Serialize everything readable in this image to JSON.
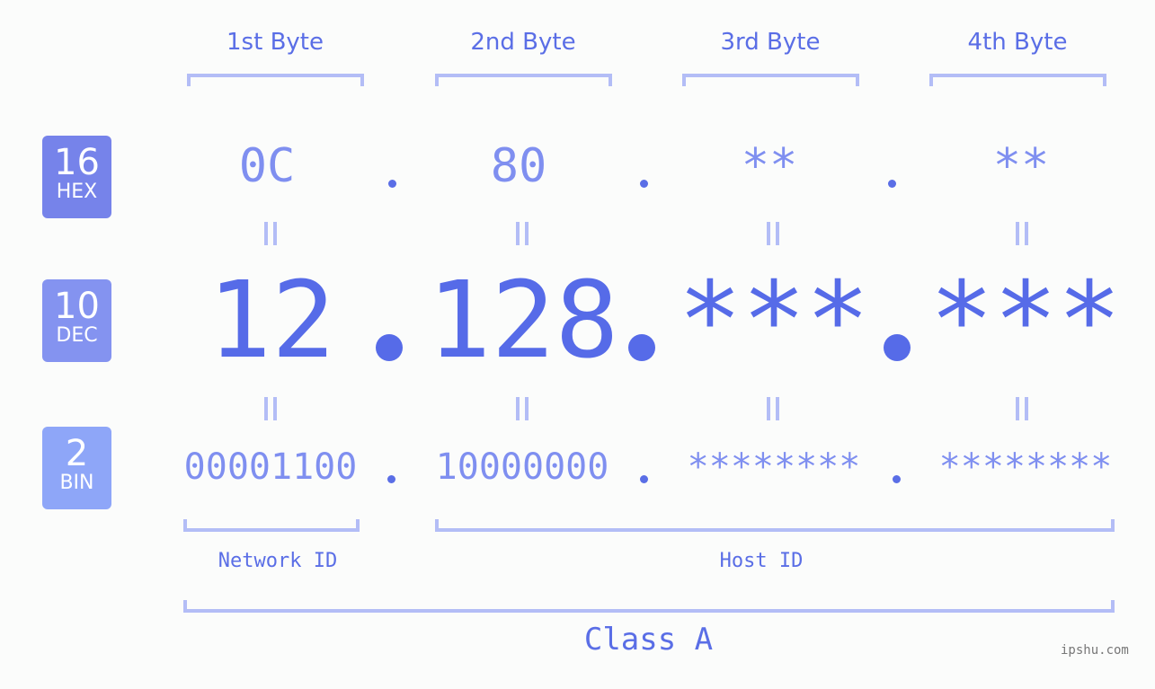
{
  "byte_headers": [
    "1st Byte",
    "2nd Byte",
    "3rd Byte",
    "4th Byte"
  ],
  "badges": {
    "hex": {
      "number": "16",
      "label": "HEX",
      "color": "#7683ea"
    },
    "dec": {
      "number": "10",
      "label": "DEC",
      "color": "#8493f0"
    },
    "bin": {
      "number": "2",
      "label": "BIN",
      "color": "#8ea6f8"
    }
  },
  "hex_values": [
    "0C",
    "80",
    "**",
    "**"
  ],
  "dec_values": [
    "12",
    "128",
    "***",
    "***"
  ],
  "bin_values": [
    "00001100",
    "10000000",
    "********",
    "********"
  ],
  "segments": {
    "network_label": "Network ID",
    "host_label": "Host ID"
  },
  "class_label": "Class A",
  "watermark": "ipshu.com",
  "colors": {
    "primary": "#566be8",
    "secondary": "#7f8ff0",
    "bracket": "#b3bdf6",
    "background": "#fbfcfb"
  }
}
